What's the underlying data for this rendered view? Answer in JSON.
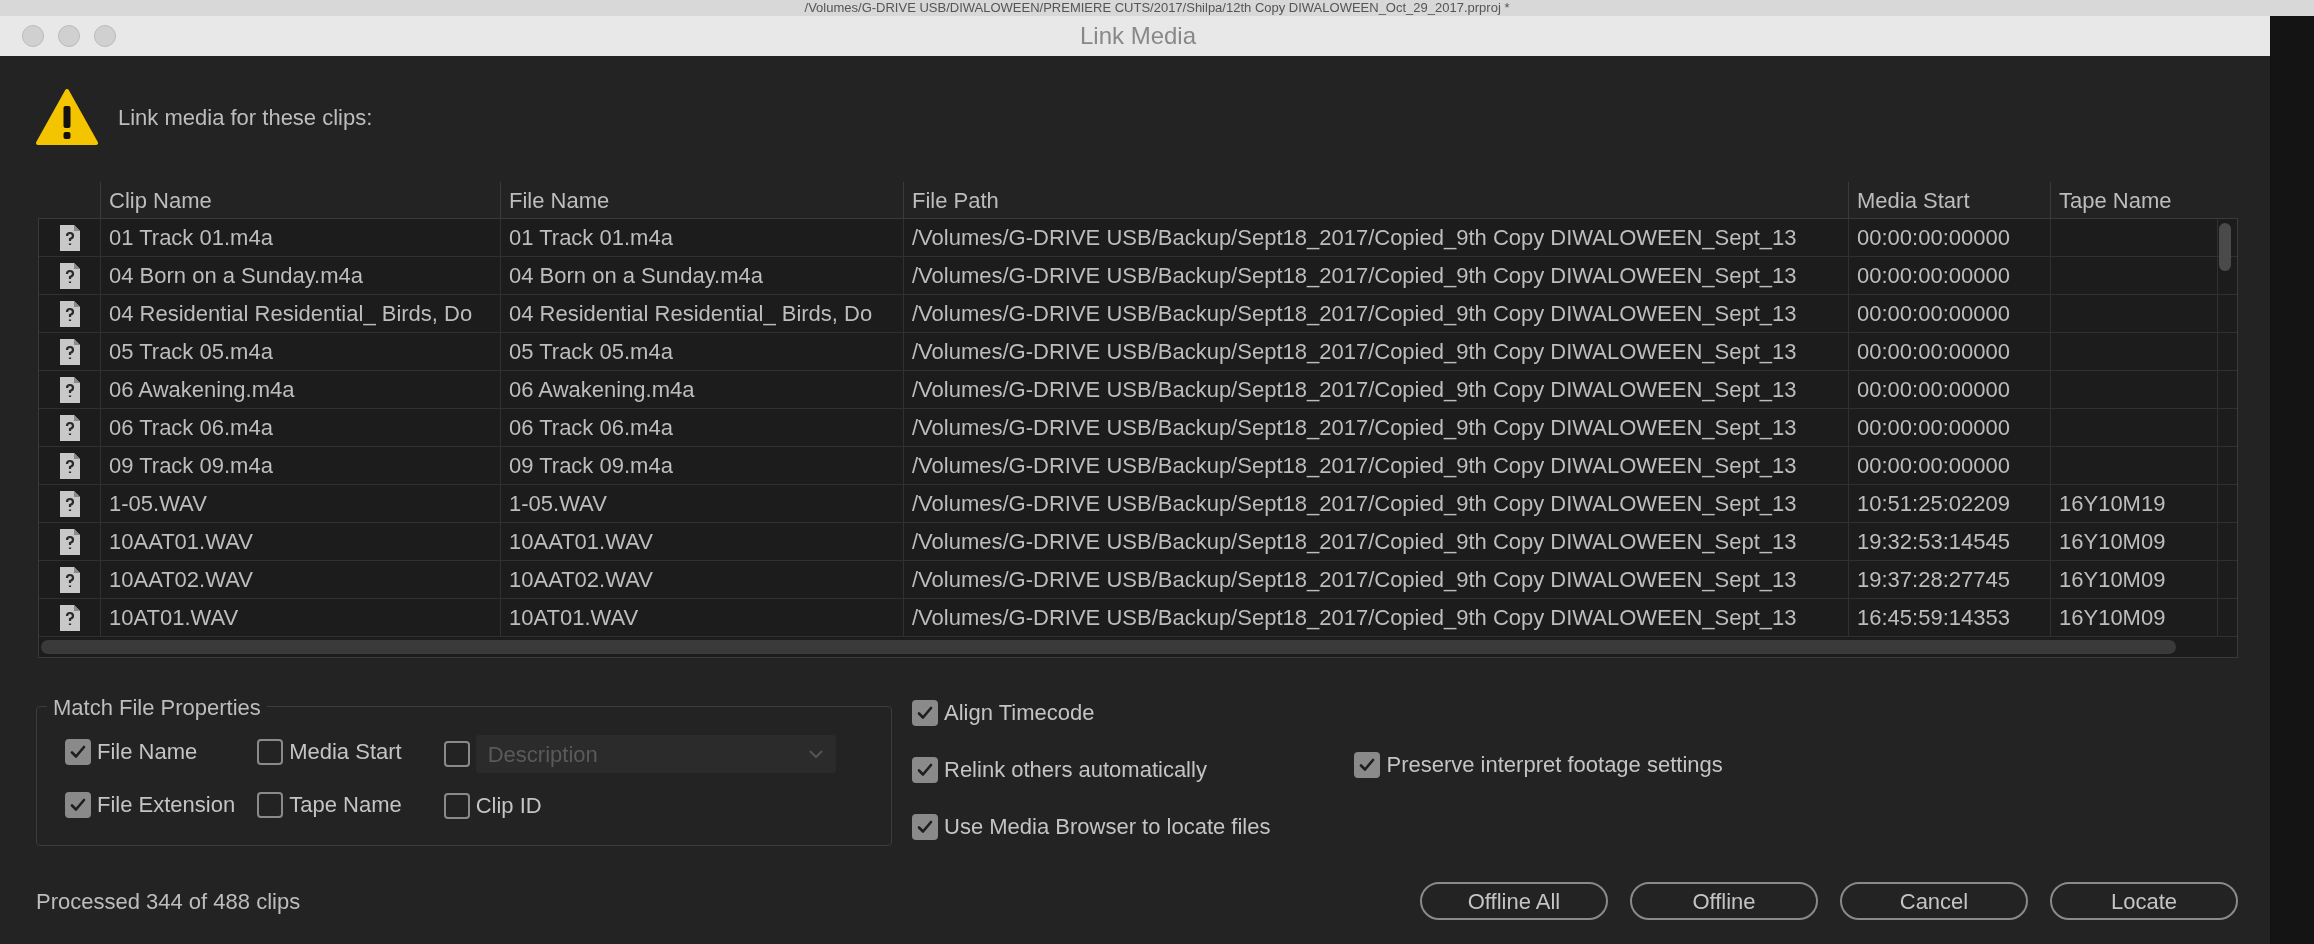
{
  "background_window": {
    "title": "/Volumes/G-DRIVE USB/DIWALOWEEN/PREMIERE CUTS/2017/Shilpa/12th Copy DIWALOWEEN_Oct_29_2017.prproj *"
  },
  "window": {
    "title": "Link Media"
  },
  "message": "Link media for these clips:",
  "table": {
    "columns": [
      "Clip Name",
      "File Name",
      "File Path",
      "Media Start",
      "Tape Name"
    ],
    "rows": [
      {
        "cells": [
          "01 Track 01.m4a",
          "01 Track 01.m4a",
          "/Volumes/G-DRIVE USB/Backup/Sept18_2017/Copied_9th Copy DIWALOWEEN_Sept_13",
          "00:00:00:00000",
          ""
        ]
      },
      {
        "cells": [
          "04 Born on a Sunday.m4a",
          "04 Born on a Sunday.m4a",
          "/Volumes/G-DRIVE USB/Backup/Sept18_2017/Copied_9th Copy DIWALOWEEN_Sept_13",
          "00:00:00:00000",
          ""
        ]
      },
      {
        "cells": [
          "04 Residential Residential_ Birds, Do",
          "04 Residential Residential_ Birds, Do",
          "/Volumes/G-DRIVE USB/Backup/Sept18_2017/Copied_9th Copy DIWALOWEEN_Sept_13",
          "00:00:00:00000",
          ""
        ]
      },
      {
        "cells": [
          "05 Track 05.m4a",
          "05 Track 05.m4a",
          "/Volumes/G-DRIVE USB/Backup/Sept18_2017/Copied_9th Copy DIWALOWEEN_Sept_13",
          "00:00:00:00000",
          ""
        ]
      },
      {
        "cells": [
          "06 Awakening.m4a",
          "06 Awakening.m4a",
          "/Volumes/G-DRIVE USB/Backup/Sept18_2017/Copied_9th Copy DIWALOWEEN_Sept_13",
          "00:00:00:00000",
          ""
        ]
      },
      {
        "cells": [
          "06 Track 06.m4a",
          "06 Track 06.m4a",
          "/Volumes/G-DRIVE USB/Backup/Sept18_2017/Copied_9th Copy DIWALOWEEN_Sept_13",
          "00:00:00:00000",
          ""
        ]
      },
      {
        "cells": [
          "09 Track 09.m4a",
          "09 Track 09.m4a",
          "/Volumes/G-DRIVE USB/Backup/Sept18_2017/Copied_9th Copy DIWALOWEEN_Sept_13",
          "00:00:00:00000",
          ""
        ]
      },
      {
        "cells": [
          "1-05.WAV",
          "1-05.WAV",
          "/Volumes/G-DRIVE USB/Backup/Sept18_2017/Copied_9th Copy DIWALOWEEN_Sept_13",
          "10:51:25:02209",
          "16Y10M19"
        ]
      },
      {
        "cells": [
          "10AAT01.WAV",
          "10AAT01.WAV",
          "/Volumes/G-DRIVE USB/Backup/Sept18_2017/Copied_9th Copy DIWALOWEEN_Sept_13",
          "19:32:53:14545",
          "16Y10M09"
        ]
      },
      {
        "cells": [
          "10AAT02.WAV",
          "10AAT02.WAV",
          "/Volumes/G-DRIVE USB/Backup/Sept18_2017/Copied_9th Copy DIWALOWEEN_Sept_13",
          "19:37:28:27745",
          "16Y10M09"
        ]
      },
      {
        "cells": [
          "10AT01.WAV",
          "10AT01.WAV",
          "/Volumes/G-DRIVE USB/Backup/Sept18_2017/Copied_9th Copy DIWALOWEEN_Sept_13",
          "16:45:59:14353",
          "16Y10M09"
        ]
      }
    ]
  },
  "match_file_properties": {
    "title": "Match File Properties",
    "columns": [
      [
        {
          "label": "File Name",
          "checked": true
        },
        {
          "label": "File Extension",
          "checked": true
        }
      ],
      [
        {
          "label": "Media Start",
          "checked": false
        },
        {
          "label": "Tape Name",
          "checked": false
        }
      ]
    ],
    "description": {
      "checked": false,
      "placeholder": "Description",
      "disabled": true
    },
    "clip_id": {
      "label": "Clip ID",
      "checked": false
    }
  },
  "options": [
    {
      "label": "Align Timecode",
      "checked": true
    },
    {
      "label": "Relink others automatically",
      "checked": true
    },
    {
      "label": "Use Media Browser to locate files",
      "checked": true
    }
  ],
  "preserve_option": {
    "label": "Preserve interpret footage settings",
    "checked": true
  },
  "status": "Processed 344 of 488 clips",
  "buttons": [
    "Offline All",
    "Offline",
    "Cancel",
    "Locate"
  ]
}
